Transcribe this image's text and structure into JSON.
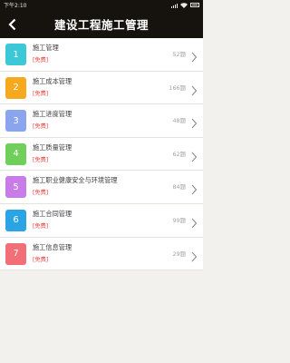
{
  "status_bar": {
    "time": "下午2:10"
  },
  "header": {
    "title": "建设工程施工管理"
  },
  "items": [
    {
      "number": "1",
      "name": "施工管理",
      "tag": "[免费]",
      "count": "52题",
      "color": "#3cc8d6"
    },
    {
      "number": "2",
      "name": "施工成本管理",
      "tag": "[免费]",
      "count": "166题",
      "color": "#f6a81f"
    },
    {
      "number": "3",
      "name": "施工进度管理",
      "tag": "[免费]",
      "count": "48题",
      "color": "#8aa4ee"
    },
    {
      "number": "4",
      "name": "施工质量管理",
      "tag": "[免费]",
      "count": "62题",
      "color": "#6fcf5a"
    },
    {
      "number": "5",
      "name": "施工职业健康安全与环境管理",
      "tag": "[免费]",
      "count": "84题",
      "color": "#c77ce8"
    },
    {
      "number": "6",
      "name": "施工合同管理",
      "tag": "[免费]",
      "count": "99题",
      "color": "#2ba4e6"
    },
    {
      "number": "7",
      "name": "施工信息管理",
      "tag": "[免费]",
      "count": "29题",
      "color": "#f36f78"
    }
  ]
}
